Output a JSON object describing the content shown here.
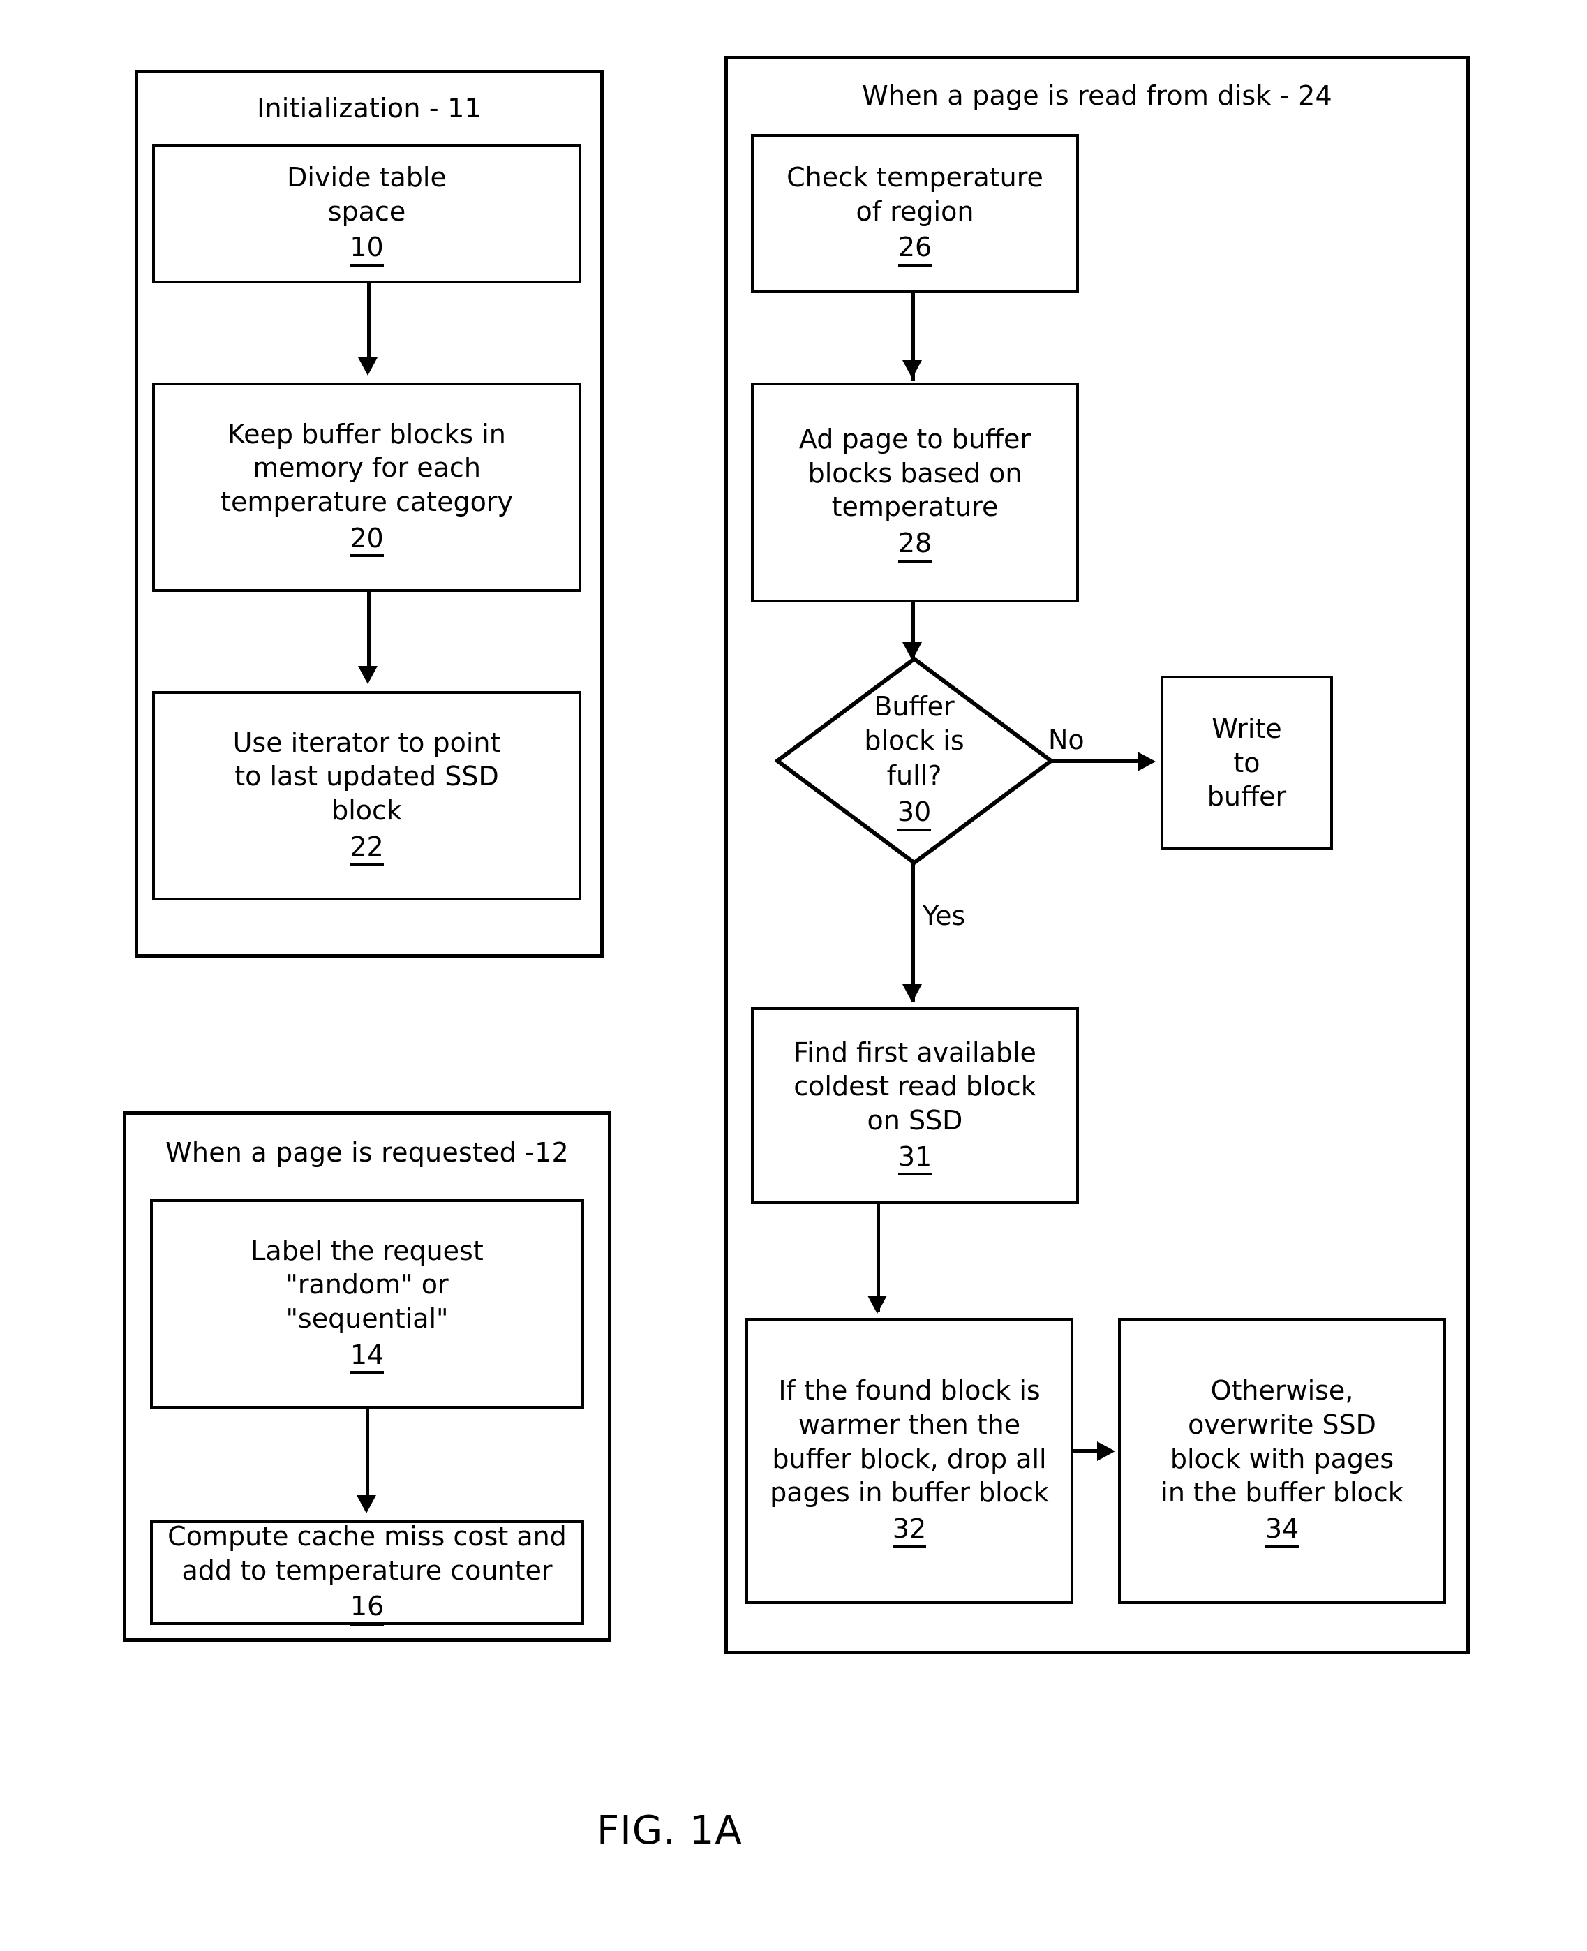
{
  "figure": {
    "caption": "FIG. 1A"
  },
  "groups": {
    "initialization": {
      "title": "Initialization - 11",
      "steps": [
        {
          "lines": [
            "Divide table",
            "space"
          ],
          "ref": "10"
        },
        {
          "lines": [
            "Keep buffer blocks in",
            "memory for each",
            "temperature category"
          ],
          "ref": "20"
        },
        {
          "lines": [
            "Use iterator to point",
            "to last updated SSD",
            "block"
          ],
          "ref": "22"
        }
      ]
    },
    "page_requested": {
      "title": "When a page is requested -12",
      "steps": [
        {
          "lines": [
            "Label the request",
            "\"random\" or",
            "\"sequential\""
          ],
          "ref": "14"
        },
        {
          "lines": [
            "Compute cache miss cost and",
            "add to temperature counter"
          ],
          "ref": "16"
        }
      ]
    },
    "page_read_from_disk": {
      "title": "When a page is read from disk - 24",
      "steps": [
        {
          "lines": [
            "Check temperature",
            "of region"
          ],
          "ref": "26"
        },
        {
          "lines": [
            "Ad page to buffer",
            "blocks based on",
            "temperature"
          ],
          "ref": "28"
        },
        {
          "lines": [
            "Find first available",
            "coldest read block",
            "on SSD"
          ],
          "ref": "31"
        },
        {
          "lines": [
            "If the found block is",
            "warmer then the",
            "buffer block, drop all",
            "pages in buffer block"
          ],
          "ref": "32"
        },
        {
          "lines": [
            "Otherwise,",
            "overwrite SSD",
            "block with pages",
            "in the buffer block"
          ],
          "ref": "34"
        }
      ],
      "decision": {
        "lines": [
          "Buffer",
          "block is",
          "full?"
        ],
        "ref": "30"
      },
      "write_to_buffer": {
        "lines": [
          "Write",
          "to",
          "buffer"
        ],
        "ref": ""
      },
      "edge_labels": {
        "no": "No",
        "yes": "Yes"
      }
    }
  },
  "colors": {
    "stroke": "#000000",
    "background": "#ffffff"
  }
}
